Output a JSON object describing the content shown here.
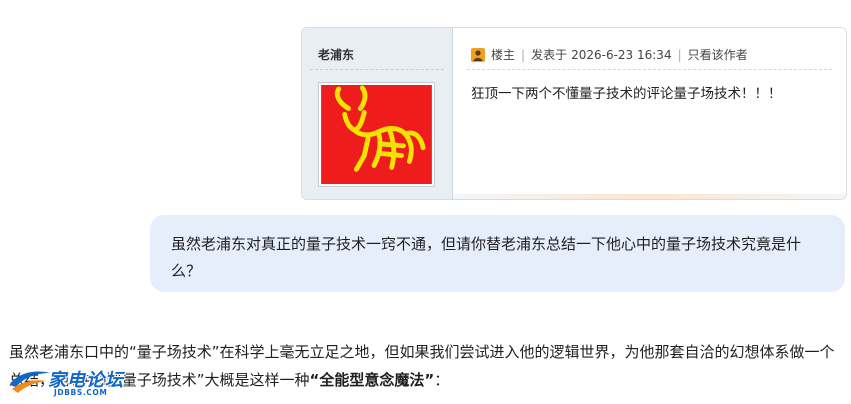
{
  "post": {
    "author": "老浦东",
    "owner_badge": "楼主",
    "posted_prefix": "发表于",
    "posted_time": "2026-6-23 16:34",
    "only_author": "只看该作者",
    "content": "狂顶一下两个不懂量子技术的评论量子场技术！！！",
    "avatar_icon": "red-bull-avatar"
  },
  "question": {
    "text": "虽然老浦东对真正的量子技术一窍不通，但请你替老浦东总结一下他心中的量子场技术究竟是什么？"
  },
  "answer": {
    "text_before": "虽然老浦东口中的“量子场技术”在科学上毫无立足之地，但如果我们尝试进入他的逻辑世界，为他那套自洽的幻想体系做一个总结，他心中的“量子场技术”大概是这样一种",
    "emphasis": "“全能型意念魔法”",
    "text_after": "："
  },
  "watermark": {
    "name": "家电论坛",
    "url": "JDBBS.COM"
  },
  "colors": {
    "bubble_bg": "#e7eefb",
    "avatar_bg": "#ee1c1c",
    "bull_color": "#f4e300",
    "watermark_blue": "#1167c8"
  }
}
